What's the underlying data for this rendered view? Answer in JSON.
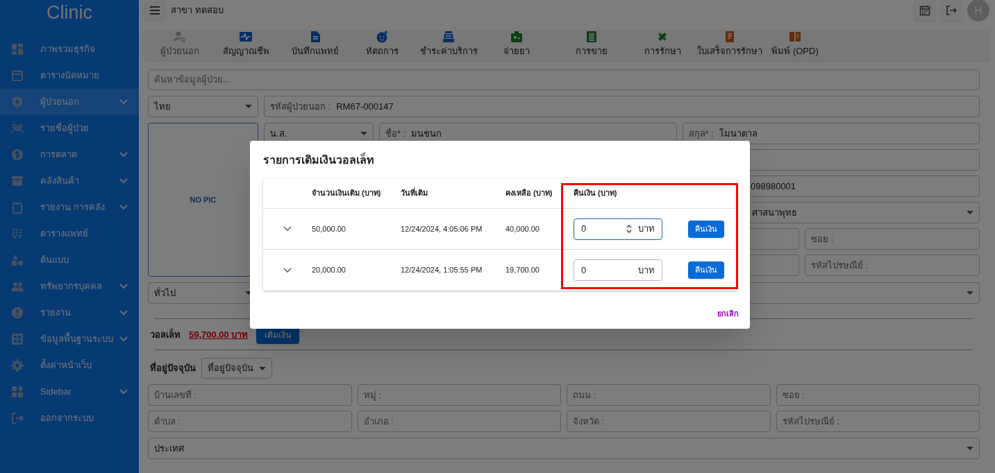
{
  "sidebar": {
    "logo": "Clinic",
    "items": [
      {
        "label": "ภาพรวมธุรกิจ",
        "selected": false,
        "has_submenu": false
      },
      {
        "label": "ตารางนัดหมาย",
        "selected": false,
        "has_submenu": false
      },
      {
        "label": "ผู้ป่วยนอก",
        "selected": true,
        "has_submenu": true
      },
      {
        "label": "รายชื่อผู้ป่วย",
        "selected": false,
        "has_submenu": false
      },
      {
        "label": "การตลาด",
        "selected": false,
        "has_submenu": true
      },
      {
        "label": "คลังสินค้า",
        "selected": false,
        "has_submenu": true
      },
      {
        "label": "รายงาน การคลัง",
        "selected": false,
        "has_submenu": true
      },
      {
        "label": "ตารางแพทย์",
        "selected": false,
        "has_submenu": false
      },
      {
        "label": "ต้นแบบ",
        "selected": false,
        "has_submenu": false
      },
      {
        "label": "ทรัพยากรบุคคล",
        "selected": false,
        "has_submenu": true
      },
      {
        "label": "รายงาน",
        "selected": false,
        "has_submenu": true
      },
      {
        "label": "ข้อมูลพื้นฐานระบบ",
        "selected": false,
        "has_submenu": true
      },
      {
        "label": "ตั้งค่าหน้าเว็บ",
        "selected": false,
        "has_submenu": false
      },
      {
        "label": "Sidebar",
        "selected": false,
        "has_submenu": true
      },
      {
        "label": "ออกจากระบบ",
        "selected": false,
        "has_submenu": false
      }
    ]
  },
  "topbar": {
    "branch": "สาขา ทดสอบ",
    "avatar": "H"
  },
  "toolbar": [
    {
      "label": "ผู้ป่วยนอก",
      "disabled": true
    },
    {
      "label": "สัญญาณชีพ",
      "disabled": false
    },
    {
      "label": "บันทึกแพทย์",
      "disabled": false
    },
    {
      "label": "หัตถการ",
      "disabled": false
    },
    {
      "label": "ชำระค่าบริการ",
      "disabled": false
    },
    {
      "label": "จ่ายยา",
      "disabled": false
    },
    {
      "label": "การขาย",
      "disabled": false
    },
    {
      "label": "การรักษา",
      "disabled": false
    },
    {
      "label": "ใบเสร็จการรักษา",
      "disabled": false
    },
    {
      "label": "พิมพ์ (OPD)",
      "disabled": false
    }
  ],
  "patient_form": {
    "search": {
      "placeholder": "ค้นหาข้อมูลผู้ป่วย..."
    },
    "nationality": "ไทย",
    "patient_id": {
      "label": "รหัสผู้ป่วยนอก :",
      "value": "RM67-000147"
    },
    "photo": "NO PIC",
    "title_prefix": "น.ส.",
    "first_name": {
      "label": "ชื่อ* :",
      "value": "มนชนก"
    },
    "last_name": {
      "label": "สกุล* :",
      "value": "โมนาตาล"
    },
    "phone_partial": "098980001",
    "religion": "ศาสนาพุทธ",
    "soi_label": "ซอย :",
    "postcode_label": "รหัสไปรษณีย์ :",
    "patient_type": "ทั่วไป"
  },
  "wallet": {
    "label": "วอลเล็ท",
    "balance": "59,700.00 บาท",
    "topup_button": "เติมเงิน"
  },
  "address": {
    "label": "ที่อยู่ปัจจุบัน",
    "type_button": "ที่อยู่ปัจจุบัน",
    "fields": [
      "บ้านเลขที่ :",
      "หมู่ :",
      "ถนน :",
      "ซอย :",
      "ตำบล :",
      "อำเภอ :",
      "จังหวัด :",
      "รหัสไปรษณีย์ :"
    ],
    "country": "ประเทศ"
  },
  "dialog": {
    "title": "รายการเติมเงินวอลเล็ท",
    "columns": [
      "จำนวนเงินเติม (บาท)",
      "วันที่เติม",
      "คงเหลือ (บาท)",
      "คืนเงิน (บาท)"
    ],
    "rows": [
      {
        "amount": "50,000.00",
        "date": "12/24/2024, 4:05:06 PM",
        "balance": "40,000.00",
        "refund": "0",
        "unit": "บาท",
        "focused": true,
        "button": "คืนเงิน"
      },
      {
        "amount": "20,000.00",
        "date": "12/24/2024, 1:05:55 PM",
        "balance": "19,700.00",
        "refund": "0",
        "unit": "บาท",
        "focused": false,
        "button": "คืนเงิน"
      }
    ],
    "cancel": "ยกเลิก"
  }
}
